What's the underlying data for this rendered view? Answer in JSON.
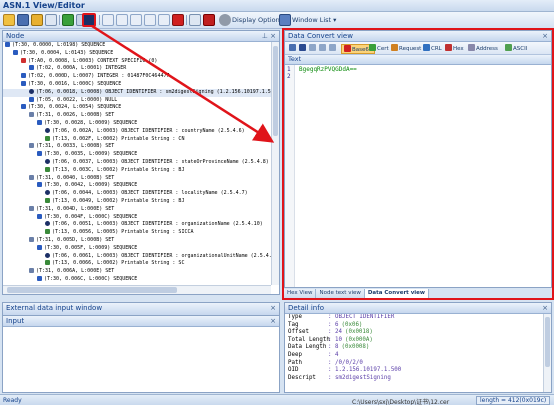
{
  "app": {
    "title": "ASN.1 View/Editor"
  },
  "toolbar": {
    "display_options_label": "Display Options",
    "window_list_label": "Window List",
    "dropdown_glyph": "▾"
  },
  "node_panel": {
    "title": "Node",
    "pin_glyph": "⊥",
    "close_glyph": "×",
    "rows": [
      "(T:30, 0.0000, L:0198) SEQUENCE",
      "(T:30, 0.0004, L:0143) SEQUENCE",
      "(T:A0, 0.0008, L:0003) CONTEXT SPECIFIC (0)",
      "(T:02, 0.000A, L:0001) INTEGER",
      "(T:02, 0.000D, L:0007) INTEGER : 01487F0C464477",
      "(T:30, 0.0016, L:000C) SEQUENCE",
      "(T:06, 0.0018, L:0008) OBJECT IDENTIFIER : sm2digestSigning (1.2.156.10197.1.501)",
      "(T:05, 0.0022, L:0000) NULL",
      "(T:30, 0.0024, L:0054) SEQUENCE",
      "(T:31, 0.0026, L:000B) SET",
      "(T:30, 0.0028, L:0009) SEQUENCE",
      "(T:06, 0.002A, L:0003) OBJECT IDENTIFIER : countryName (2.5.4.6)",
      "(T:13, 0.002F, L:0002) Printable String : CN",
      "(T:31, 0.0033, L:000B) SET",
      "(T:30, 0.0035, L:0009) SEQUENCE",
      "(T:06, 0.0037, L:0003) OBJECT IDENTIFIER : stateOrProvinceName (2.5.4.8)",
      "(T:13, 0.003C, L:0002) Printable String : BJ",
      "(T:31, 0.0040, L:000B) SET",
      "(T:30, 0.0042, L:0009) SEQUENCE",
      "(T:06, 0.0044, L:0003) OBJECT IDENTIFIER : localityName (2.5.4.7)",
      "(T:13, 0.0049, L:0002) Printable String : BJ",
      "(T:31, 0.004D, L:000E) SET",
      "(T:30, 0.004F, L:000C) SEQUENCE",
      "(T:06, 0.0051, L:0003) OBJECT IDENTIFIER : organizationName (2.5.4.10)",
      "(T:13, 0.0056, L:0005) Printable String : SICCA",
      "(T:31, 0.005D, L:000B) SET",
      "(T:30, 0.005F, L:0009) SEQUENCE",
      "(T:06, 0.0061, L:0003) OBJECT IDENTIFIER : organizationalUnitName (2.5.4.11)",
      "(T:13, 0.0066, L:0002) Printable String : SC",
      "(T:31, 0.006A, L:000E) SET",
      "(T:30, 0.006C, L:000C) SEQUENCE"
    ]
  },
  "data_convert": {
    "title": "Data Convert view",
    "buttons": [
      "Base64",
      "Cert",
      "Request",
      "CRL",
      "Hex",
      "Address",
      "ASCII"
    ],
    "text_label": "Text",
    "line_numbers": [
      "1",
      "2"
    ],
    "code_lines": [
      "BgegqRzPVQGDdA==",
      ""
    ],
    "close_glyph": "×"
  },
  "center_tabs": [
    "Hex View",
    "Node text view",
    "Data Convert view"
  ],
  "external_panel": {
    "title": "External data input window",
    "close_glyph": "×"
  },
  "input_panel": {
    "title": "Input",
    "close_glyph": "×"
  },
  "detail_panel": {
    "title": "Detail info",
    "close_glyph": "×",
    "rows": [
      {
        "key": "Type",
        "val": ": OBJECT IDENTIFIER",
        "hex": ""
      },
      {
        "key": "Tag",
        "val": ": 6",
        "hex": "(0x06)"
      },
      {
        "key": "Offset",
        "val": ": 24",
        "hex": "(0x0018)"
      },
      {
        "key": "Total Length",
        "val": ": 10",
        "hex": "(0x000A)"
      },
      {
        "key": "Data Length",
        "val": ": 8",
        "hex": "(0x0008)"
      },
      {
        "key": "Deep",
        "val": ": 4",
        "hex": ""
      },
      {
        "key": "Path",
        "val": ": /0/0/2/0",
        "hex": ""
      },
      {
        "key": "OID",
        "val": ": 1.2.156.10197.1.500",
        "hex": ""
      },
      {
        "key": "Descript",
        "val": ": sm2digestSigning",
        "hex": ""
      }
    ]
  },
  "status": {
    "ready": "Ready",
    "path": "C:\\Users\\sxj\\Desktop\\证书\\12.cer",
    "length": "length = 412(0x019c)"
  },
  "colors": {
    "highlight": "#e0141a",
    "accent": "#15428b"
  }
}
